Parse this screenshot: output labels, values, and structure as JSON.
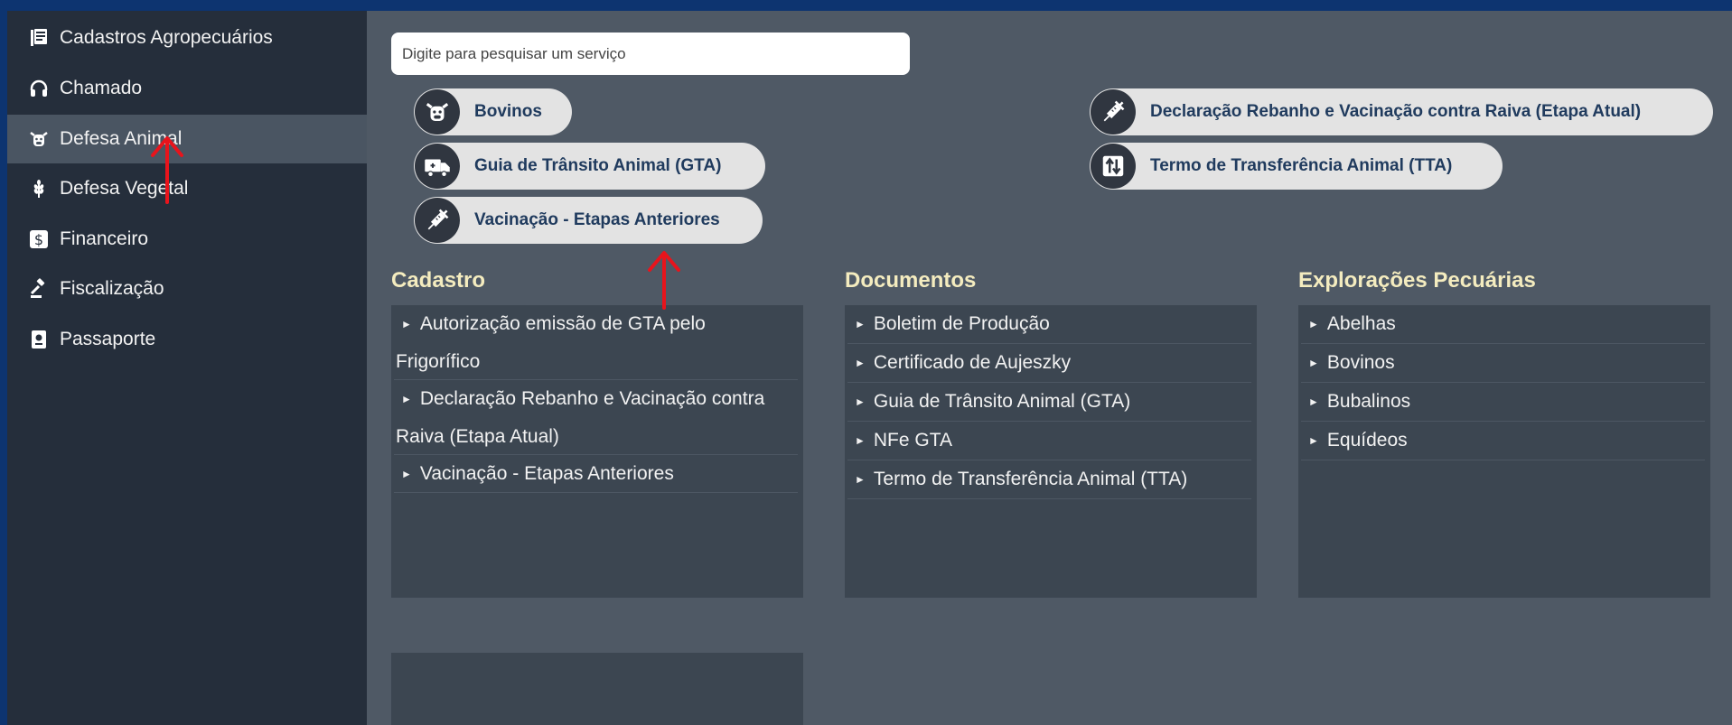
{
  "sidebar": {
    "items": [
      {
        "label": "Cadastros Agropecuários",
        "icon": "book-icon"
      },
      {
        "label": "Chamado",
        "icon": "headset-icon"
      },
      {
        "label": "Defesa Animal",
        "icon": "cow-icon",
        "active": true
      },
      {
        "label": "Defesa Vegetal",
        "icon": "wheat-icon"
      },
      {
        "label": "Financeiro",
        "icon": "dollar-icon"
      },
      {
        "label": "Fiscalização",
        "icon": "gavel-icon"
      },
      {
        "label": "Passaporte",
        "icon": "passport-icon"
      }
    ]
  },
  "search": {
    "placeholder": "Digite para pesquisar um serviço"
  },
  "quick_links": [
    {
      "label": "Bovinos",
      "icon": "cow-icon"
    },
    {
      "label": "Guia de Trânsito Animal (GTA)",
      "icon": "truck-icon"
    },
    {
      "label": "Vacinação - Etapas Anteriores",
      "icon": "syringe-icon"
    },
    {
      "label": "Declaração Rebanho e Vacinação contra Raiva (Etapa Atual)",
      "icon": "syringe-icon"
    },
    {
      "label": "Termo de Transferência Animal (TTA)",
      "icon": "transfer-icon"
    }
  ],
  "sections": {
    "cadastro": {
      "title": "Cadastro",
      "items": [
        {
          "line1": "Autorização emissão de GTA pelo",
          "line2": "Frigorífico"
        },
        {
          "line1": "Declaração Rebanho e Vacinação contra",
          "line2": "Raiva (Etapa Atual)"
        },
        {
          "line1": "Vacinação - Etapas Anteriores"
        }
      ]
    },
    "documentos": {
      "title": "Documentos",
      "items": [
        "Boletim de Produção",
        "Certificado de Aujeszky",
        "Guia de Trânsito Animal (GTA)",
        "NFe GTA",
        "Termo de Transferência Animal (TTA)"
      ]
    },
    "exploracoes": {
      "title": "Explorações Pecuárias",
      "items": [
        "Abelhas",
        "Bovinos",
        "Bubalinos",
        "Equídeos"
      ]
    }
  },
  "colors": {
    "annotation_arrow": "#e8141c",
    "section_title": "#f4ecbf",
    "pill_text": "#203b5e"
  }
}
